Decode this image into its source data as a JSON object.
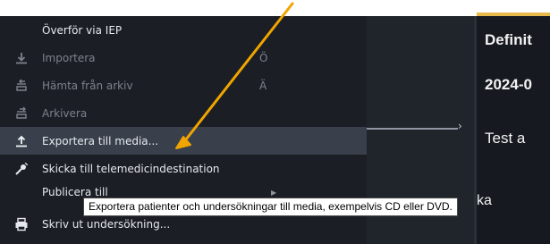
{
  "menu": {
    "items": [
      {
        "label": "Överför via IEP",
        "shortcut": "",
        "icon": "none",
        "disabled": false
      },
      {
        "label": "Importera",
        "shortcut": "Ö",
        "icon": "download-icon",
        "disabled": true
      },
      {
        "label": "Hämta från arkiv",
        "shortcut": "Ä",
        "icon": "archive-retrieve-icon",
        "disabled": true
      },
      {
        "label": "Arkivera",
        "shortcut": "",
        "icon": "archive-icon",
        "disabled": true
      },
      {
        "label": "Exportera till media...",
        "shortcut": "",
        "icon": "upload-icon",
        "disabled": false,
        "highlighted": true
      },
      {
        "label": "Skicka till telemedicindestination",
        "shortcut": "",
        "icon": "send-satellite-icon",
        "disabled": false
      },
      {
        "label": "Publicera till",
        "shortcut": "",
        "icon": "none",
        "disabled": false,
        "submenu": true
      },
      {
        "label": "Skriv ut undersökning...",
        "shortcut": "",
        "icon": "printer-icon",
        "disabled": false
      }
    ]
  },
  "tooltip": {
    "text": "Exportera patienter och undersökningar till media, exempelvis CD eller DVD."
  },
  "right_pane": {
    "title": "Definit",
    "date": "2024-0",
    "test": "Test a",
    "fragment": "ka"
  },
  "colors": {
    "menu_bg": "#1b1e24",
    "highlight": "#3a404b",
    "accent": "#e7b84a",
    "annotation_arrow": "#f0a500"
  }
}
